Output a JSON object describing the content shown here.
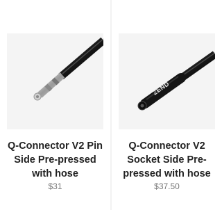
{
  "products": [
    {
      "title": "Q-Connector V2 Pin Side Pre-pressed with hose",
      "price": "$31",
      "image_icon": "pin-connector-hose-image"
    },
    {
      "title": "Q-Connector V2 Socket Side Pre-pressed with hose",
      "price": "$37.50",
      "image_icon": "socket-connector-hose-image",
      "brand_mark": "ZEND"
    }
  ]
}
